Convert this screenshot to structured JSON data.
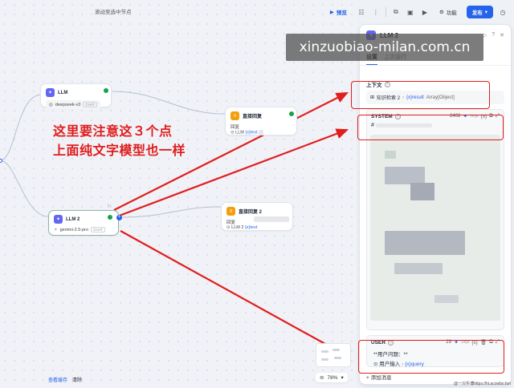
{
  "canvas_hint": "滚动至选中节点",
  "toolbar": {
    "preview": "预览",
    "features": "功能",
    "publish": "发布"
  },
  "nodes": {
    "llm1": {
      "title": "LLM",
      "model": "deepseek-v3",
      "tag": "CHAT"
    },
    "answer1": {
      "title": "直接回复",
      "label": "回复",
      "ref_node": "LLM",
      "ref_var": "text"
    },
    "llm2": {
      "title": "LLM 2",
      "model": "gemini-2.5-pro",
      "tag": "CHAT"
    },
    "answer2": {
      "title": "直接回复 2",
      "label": "回复",
      "ref_node": "LLM 2",
      "ref_var": "text"
    }
  },
  "annotation": {
    "line1": "这里要注意这３个点",
    "line2": "上面纯文字模型也一样"
  },
  "bottom": {
    "view_log": "查看缓存",
    "clear": "清除",
    "zoom": "78%"
  },
  "panel": {
    "title": "LLM 2",
    "tabs": [
      "设置",
      "上次运行"
    ],
    "context_label": "上下文",
    "context_source": "知识检索 2",
    "context_var": "result",
    "context_type": "Array[Object]",
    "system_label": "SYSTEM",
    "system_count": "2402",
    "system_hash": "#",
    "user_label": "USER",
    "user_count": "29",
    "user_line1": "**用户问题：**",
    "user_line2": "用户输入",
    "user_var": "query",
    "add_message": "添加消息",
    "jinja": "Jinja"
  },
  "watermark": "xinzuobiao-milan.com.cn",
  "credit": "@一只牛博https://hi.acowbo.fun"
}
